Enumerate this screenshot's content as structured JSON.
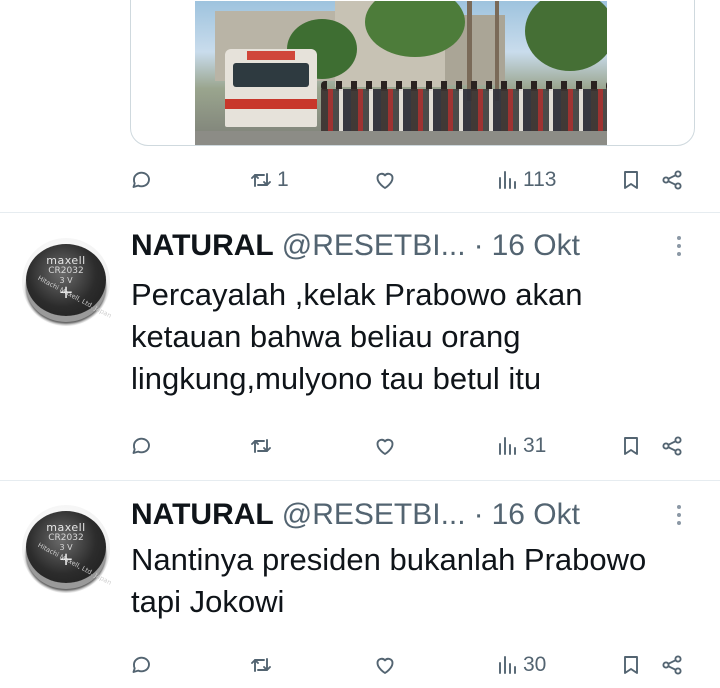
{
  "top_tweet": {
    "actions": {
      "replies": "",
      "retweets": "1",
      "likes": "",
      "views": "113"
    }
  },
  "tweets": [
    {
      "name": "NATURAL",
      "handle": "@RESETBI...",
      "separator": "·",
      "date": "16 Okt",
      "avatar": {
        "brand": "maxell",
        "model": "CR2032",
        "voltage": "3 V",
        "polarity": "+",
        "maker": "Hitachi Maxell, Ltd. Japan"
      },
      "text": "Percayalah ,kelak Prabowo akan ketauan bahwa beliau orang lingkung,mulyono tau betul itu",
      "actions": {
        "replies": "",
        "retweets": "",
        "likes": "",
        "views": "31"
      }
    },
    {
      "name": "NATURAL",
      "handle": "@RESETBI...",
      "separator": "·",
      "date": "16 Okt",
      "avatar": {
        "brand": "maxell",
        "model": "CR2032",
        "voltage": "3 V",
        "polarity": "+",
        "maker": "Hitachi Maxell, Ltd. Japan"
      },
      "text": "Nantinya presiden bukanlah Prabowo tapi Jokowi",
      "actions": {
        "replies": "",
        "retweets": "",
        "likes": "",
        "views": "30"
      }
    }
  ],
  "icons": [
    "reply-icon",
    "retweet-icon",
    "like-icon",
    "views-icon",
    "bookmark-icon",
    "share-icon",
    "more-icon"
  ],
  "colors": {
    "text": "#0f1419",
    "muted": "#536471",
    "divider": "#e6ecf0",
    "card_border": "#cfd9de"
  }
}
